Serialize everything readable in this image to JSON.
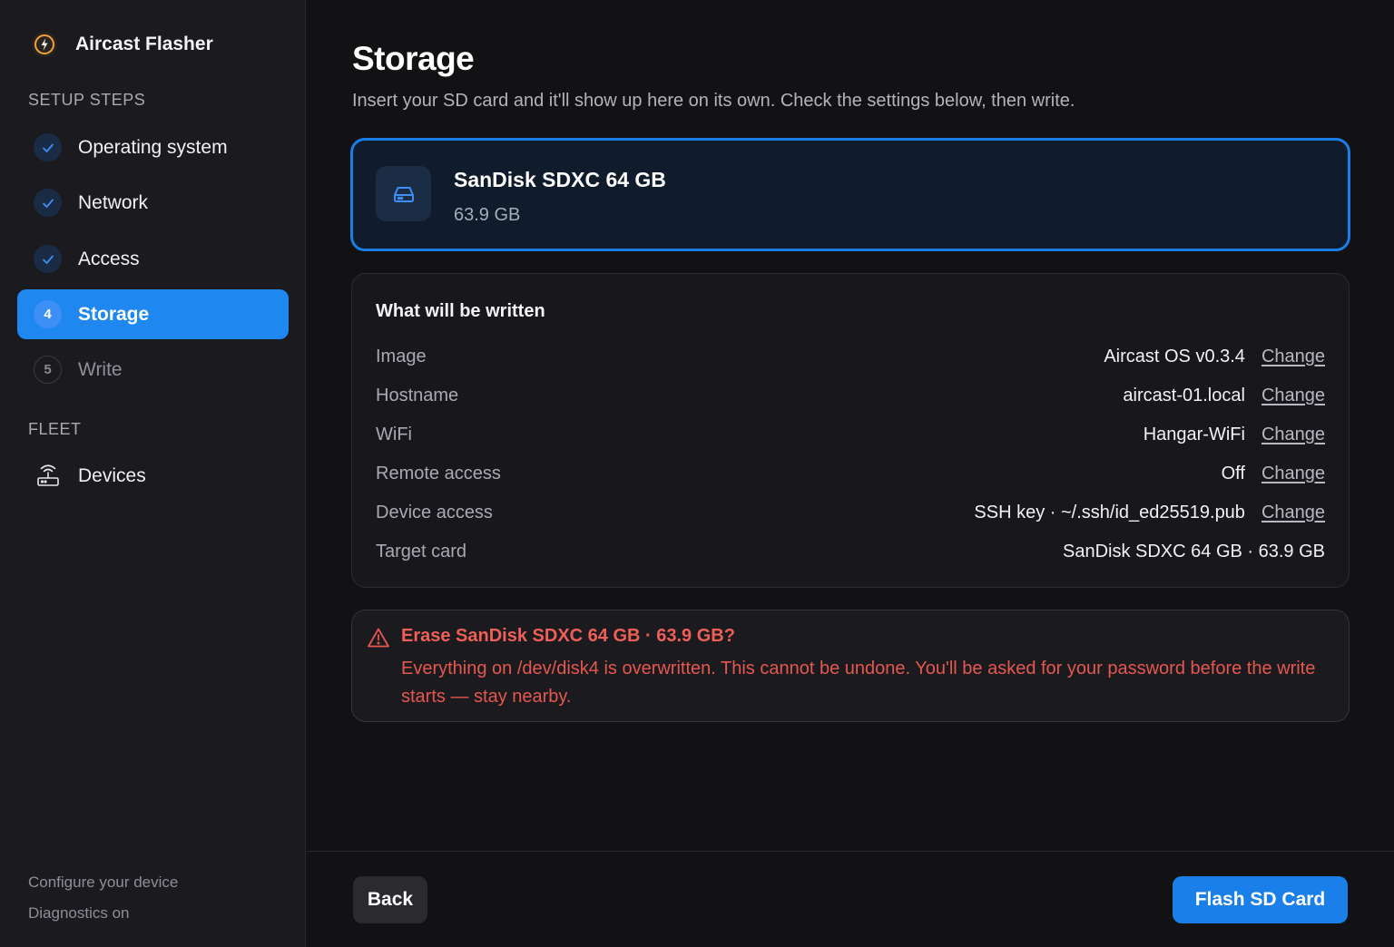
{
  "app": {
    "title": "Aircast Flasher",
    "icon": "lightning-bolt-icon",
    "accent": "#1e88f0"
  },
  "sidebar": {
    "setup_label": "SETUP STEPS",
    "steps": [
      {
        "label": "Operating system",
        "state": "done",
        "badge": ""
      },
      {
        "label": "Network",
        "state": "done",
        "badge": ""
      },
      {
        "label": "Access",
        "state": "done",
        "badge": ""
      },
      {
        "label": "Storage",
        "state": "current",
        "badge": "4"
      },
      {
        "label": "Write",
        "state": "pending",
        "badge": "5"
      }
    ],
    "fleet_label": "FLEET",
    "fleet_items": [
      {
        "label": "Devices",
        "icon": "router-icon"
      }
    ],
    "footer": {
      "line1": "Configure your device",
      "line2": "Diagnostics on"
    }
  },
  "main": {
    "title": "Storage",
    "subtitle": "Insert your SD card and it'll show up here on its own. Check the settings below, then write.",
    "selected_card": {
      "name": "SanDisk SDXC 64 GB",
      "size": "63.9 GB",
      "icon": "drive-icon"
    },
    "summary": {
      "heading": "What will be written",
      "change_label": "Change",
      "rows": [
        {
          "label": "Image",
          "value": "Aircast OS v0.3.4"
        },
        {
          "label": "Hostname",
          "value": "aircast-01.local"
        },
        {
          "label": "WiFi",
          "value": "Hangar-WiFi"
        },
        {
          "label": "Remote access",
          "value": "Off"
        },
        {
          "label": "Device access",
          "value": "SSH key · ~/.ssh/id_ed25519.pub"
        },
        {
          "label": "Target card",
          "value": "SanDisk SDXC 64 GB · 63.9 GB"
        }
      ]
    },
    "warning": {
      "icon": "warning-triangle-icon",
      "title": "Erase SanDisk SDXC 64 GB · 63.9 GB?",
      "body": "Everything on /dev/disk4 is overwritten. This cannot be undone. You'll be asked for your password before the write starts — stay nearby.",
      "color": "#e5574f"
    },
    "actions": {
      "back_label": "Back",
      "flash_label": "Flash SD Card"
    }
  }
}
